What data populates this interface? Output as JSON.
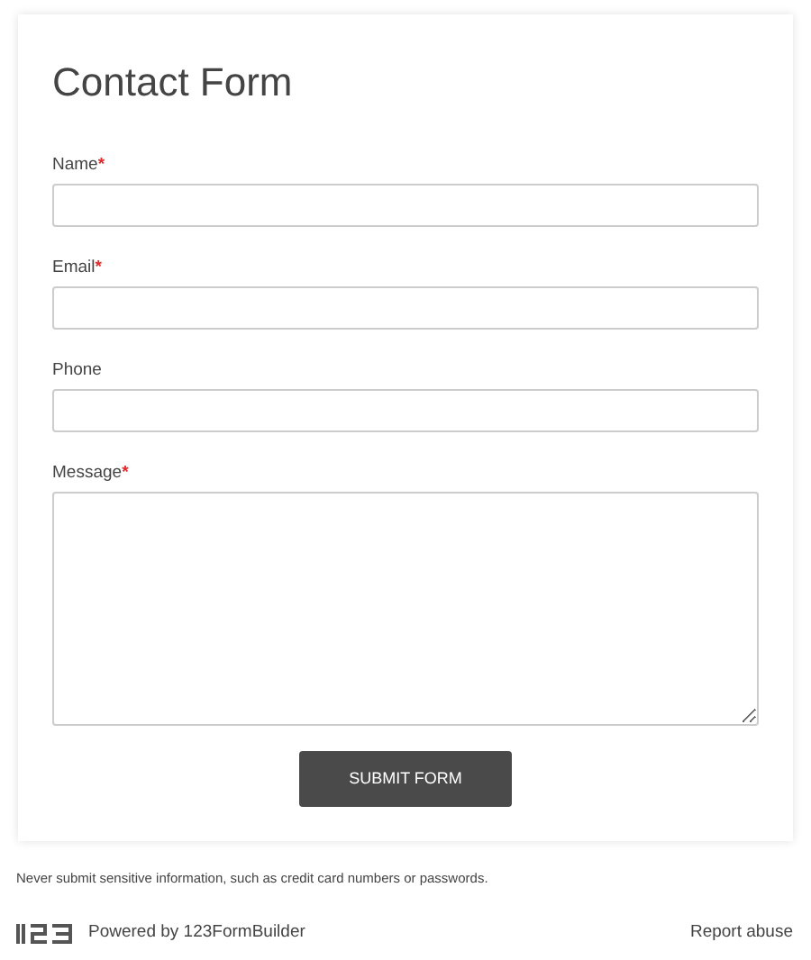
{
  "form": {
    "title": "Contact Form",
    "fields": [
      {
        "label": "Name",
        "required": true,
        "kind": "input"
      },
      {
        "label": "Email",
        "required": true,
        "kind": "input"
      },
      {
        "label": "Phone",
        "required": false,
        "kind": "input"
      },
      {
        "label": "Message",
        "required": true,
        "kind": "textarea"
      }
    ],
    "required_mark": "*",
    "submit": "SUBMIT FORM"
  },
  "disclaimer": "Never submit sensitive information, such as credit card numbers or passwords.",
  "footer": {
    "powered_by": "Powered by 123FormBuilder",
    "report": "Report abuse"
  }
}
